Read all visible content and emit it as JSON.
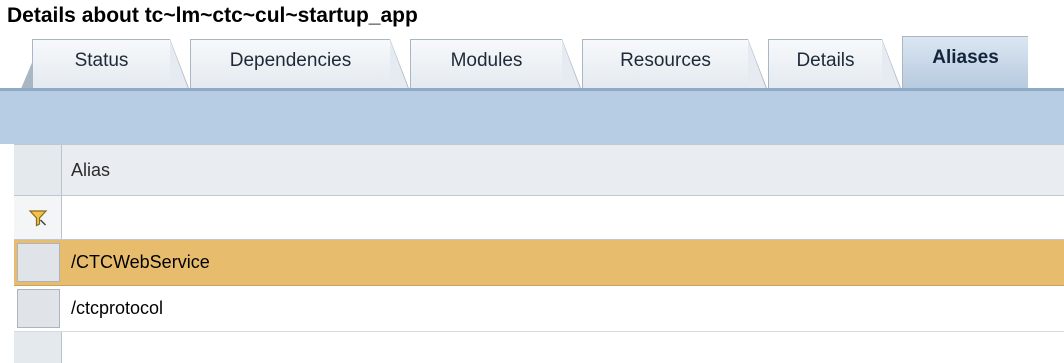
{
  "title": "Details about tc~lm~ctc~cul~startup_app",
  "tabs": [
    {
      "label": "Status"
    },
    {
      "label": "Dependencies"
    },
    {
      "label": "Modules"
    },
    {
      "label": "Resources"
    },
    {
      "label": "Details"
    },
    {
      "label": "Aliases",
      "active": true
    }
  ],
  "table": {
    "column_header": "Alias",
    "rows": [
      {
        "alias": "/CTCWebService",
        "selected": true
      },
      {
        "alias": "/ctcprotocol",
        "selected": false
      }
    ]
  },
  "colors": {
    "toolbar": "#b7cde3",
    "selected_row": "#e8bc6d",
    "header_bg": "#e9edf1",
    "filter_icon": "#d89a1e"
  },
  "icons": {
    "filter": "filter-icon"
  }
}
